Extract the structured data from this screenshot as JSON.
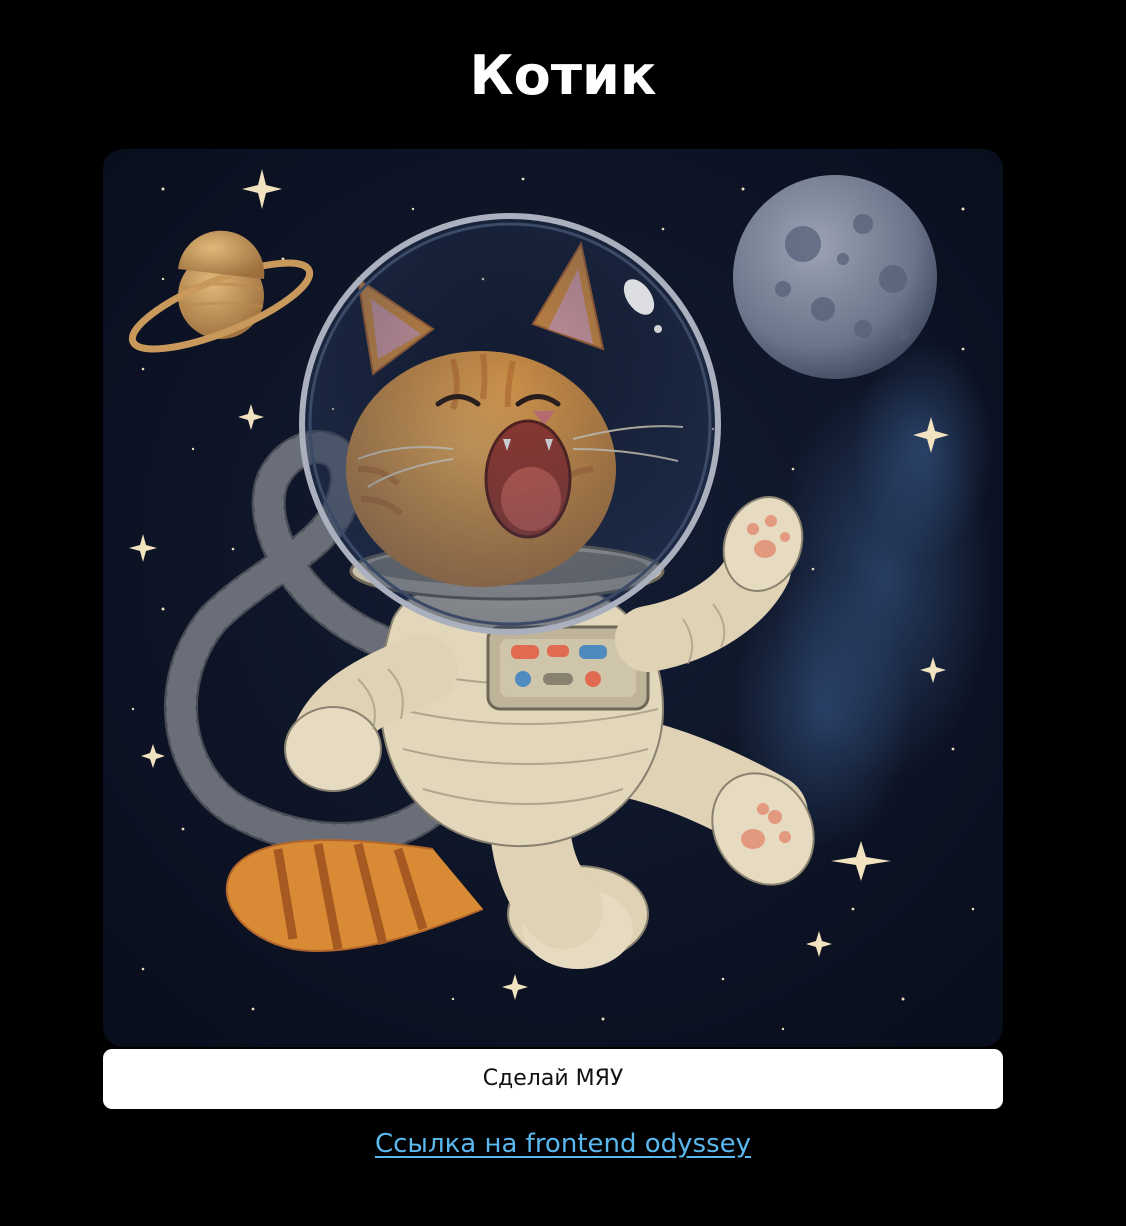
{
  "page": {
    "title": "Котик"
  },
  "image": {
    "subject": "cat-astronaut-illustration"
  },
  "actions": {
    "meow_button_label": "Сделай МЯУ",
    "link_text": "Ссылка на frontend odyssey"
  },
  "colors": {
    "background": "#000000",
    "title": "#ffffff",
    "button_bg": "#ffffff",
    "button_text": "#111111",
    "link": "#5ab8ef",
    "space": "#0c1326"
  }
}
